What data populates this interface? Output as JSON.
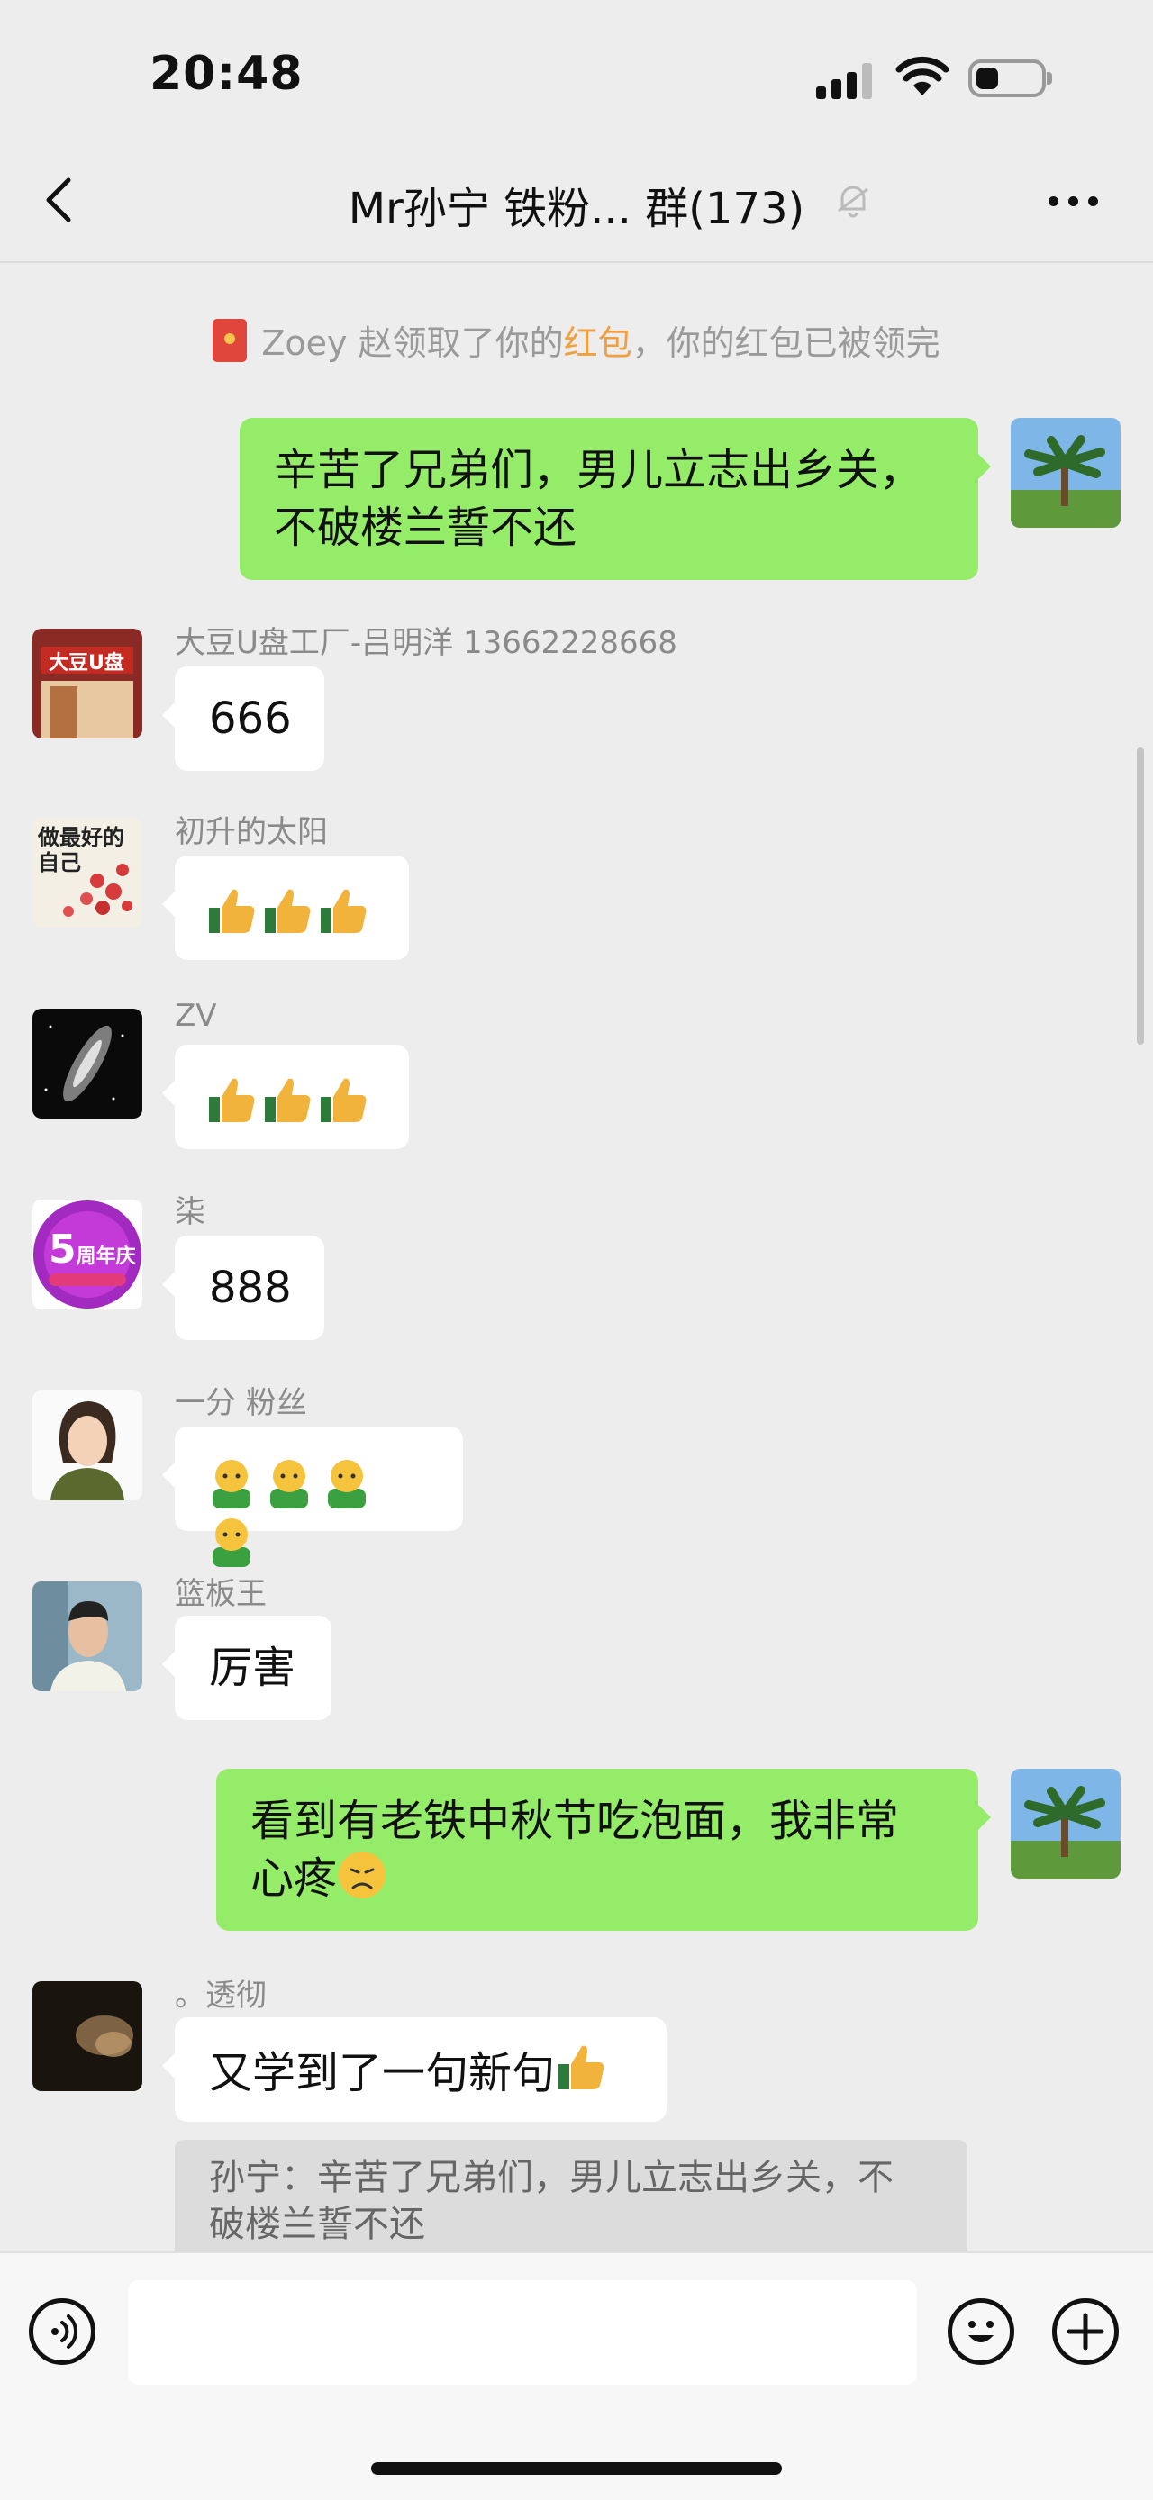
{
  "status_bar": {
    "time": "20:48"
  },
  "nav": {
    "title": "Mr孙宁 铁粉... 群(173)"
  },
  "notice": {
    "prefix": "Zoey 赵领取了你的",
    "highlight": "红包",
    "suffix": "，你的红包已被领完"
  },
  "messages": [
    {
      "type": "out",
      "text_line1": "辛苦了兄弟们，男儿立志出乡关，",
      "text_line2": "不破楼兰誓不还"
    },
    {
      "type": "in",
      "sender": "大豆U盘工厂-吕明洋 13662228668",
      "text": "666"
    },
    {
      "type": "in",
      "sender": "初升的太阳",
      "text": "",
      "emoji": "thumbs-up x3"
    },
    {
      "type": "in",
      "sender": "ZV",
      "text": "",
      "emoji": "thumbs-up x3"
    },
    {
      "type": "in",
      "sender": "柒",
      "text": "888"
    },
    {
      "type": "in",
      "sender": "一分 粉丝",
      "text": "",
      "emoji": "shy-face x4"
    },
    {
      "type": "in",
      "sender": "篮板王",
      "text": "厉害"
    },
    {
      "type": "out",
      "text_line1": "看到有老铁中秋节吃泡面，我非常",
      "text_line2": "心疼"
    },
    {
      "type": "in",
      "sender": "。透彻",
      "text": "又学到了一句新句"
    }
  ],
  "quote": {
    "text_line1": "孙宁：辛苦了兄弟们，男儿立志出乡关，不",
    "text_line2": "破楼兰誓不还"
  },
  "avatar_texts": {
    "dadou": "大豆U盘",
    "sun_line1": "做最好的",
    "sun_line2": "自己",
    "qi_number": "5",
    "qi_label": "周年庆"
  },
  "input": {
    "placeholder": ""
  },
  "colors": {
    "out_bubble": "#95ec69",
    "in_bubble": "#ffffff",
    "background": "#ededed",
    "highlight": "#f0a040"
  }
}
